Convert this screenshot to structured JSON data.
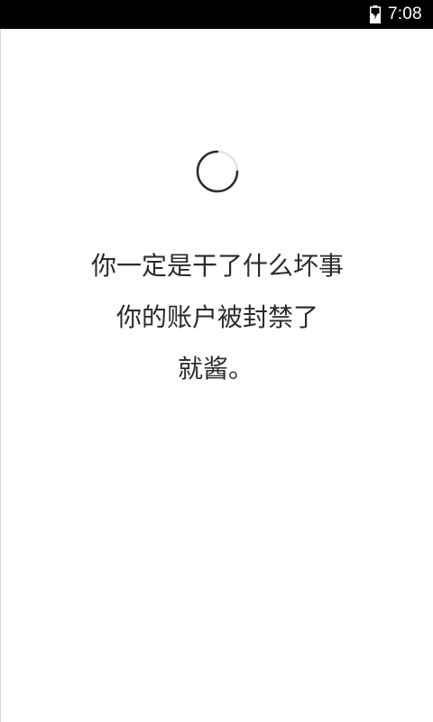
{
  "status_bar": {
    "time": "7:08",
    "battery_icon": "battery-charging-icon",
    "background": "#000000"
  },
  "loading": {
    "icon": "loading-spinner-icon"
  },
  "message": {
    "line1": "你一定是干了什么坏事",
    "line2": "你的账户被封禁了",
    "line3": "就酱。"
  },
  "colors": {
    "background": "#ffffff",
    "text": "#2b2b2b"
  }
}
